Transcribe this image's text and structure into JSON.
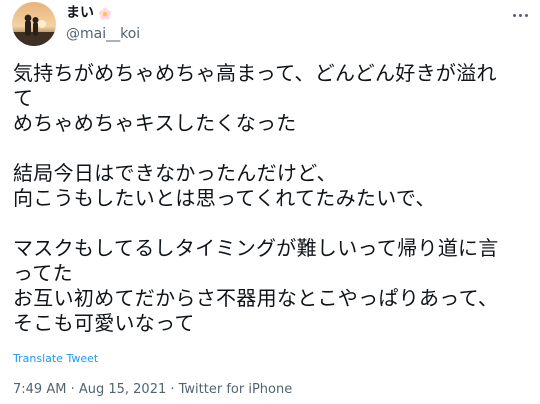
{
  "author": {
    "display_name": "まい",
    "username": "@mai__koi"
  },
  "icons": {
    "avatar": "profile-photo-sunset",
    "badge": "flower-emoji",
    "more": "more-horizontal-icon"
  },
  "tweet": {
    "text": "気持ちがめちゃめちゃ高まって、どんどん好きが溢れ\nて\nめちゃめちゃキスしたくなった\n\n結局今日はできなかったんだけど、\n向こうもしたいとは思ってくれてたみたいで、\n\nマスクもしてるしタイミングが難しいって帰り道に言\nってた\nお互い初めてだからさ不器用なとこやっぱりあって、\nそこも可愛いなって",
    "translate_label": "Translate Tweet"
  },
  "meta": {
    "timestamp": "7:49 AM · Aug 15, 2021 · Twitter for iPhone"
  },
  "colors": {
    "text": "#0f1419",
    "secondary": "#536471",
    "link": "#1d9bf0"
  }
}
